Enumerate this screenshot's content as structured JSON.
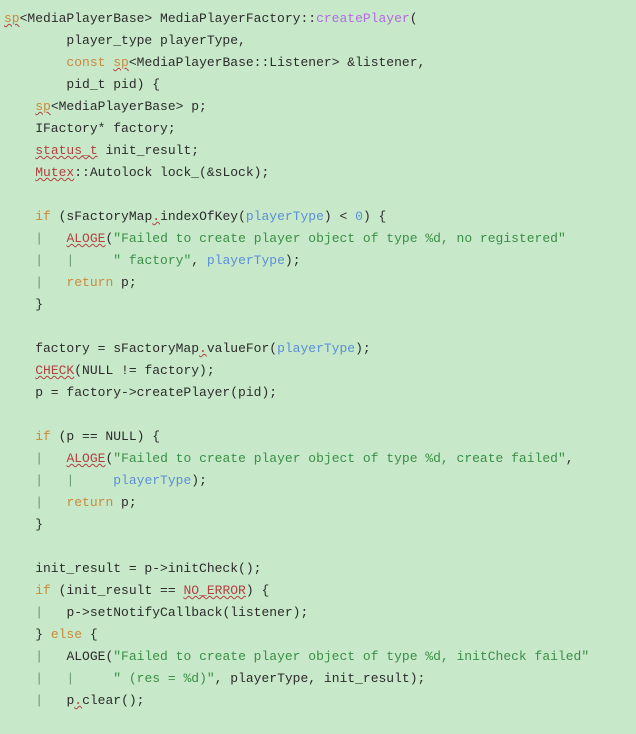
{
  "code": {
    "l1": {
      "a": "sp",
      "b": "<MediaPlayerBase> MediaPlayerFactory::",
      "c": "createPlayer",
      "d": "("
    },
    "l2": {
      "a": "        player_type playerType,"
    },
    "l3": {
      "a": "        ",
      "b": "const",
      "c": " ",
      "d": "sp",
      "e": "<MediaPlayerBase::Listener> &listener,"
    },
    "l4": {
      "a": "        pid_t pid) {"
    },
    "l5": {
      "a": "    ",
      "b": "sp",
      "c": "<MediaPlayerBase> p;"
    },
    "l6": {
      "a": "    IFactory* factory;"
    },
    "l7": {
      "a": "    ",
      "b": "status_t",
      "c": " init_result;"
    },
    "l8": {
      "a": "    ",
      "b": "Mutex",
      "c": "::Autolock lock_(&sLock);"
    },
    "l9": {
      "a": ""
    },
    "l10": {
      "a": "    ",
      "b": "if",
      "c": " (sFactoryMap",
      "d": ".",
      "e": "indexOfKey(",
      "f": "playerType",
      "g": ") < ",
      "h": "0",
      "i": ") {"
    },
    "l11": {
      "a": "    ",
      "g": "|   ",
      "b": "ALOGE",
      "c": "(",
      "d": "\"Failed to create player object of type %d, no registered\""
    },
    "l12": {
      "a": "    ",
      "g": "|   ",
      "h": "|     ",
      "d": "\" factory\"",
      "e": ", ",
      "f": "playerType",
      "i": ");"
    },
    "l13": {
      "a": "    ",
      "g": "|   ",
      "b": "return",
      "c": " p;"
    },
    "l14": {
      "a": "    }"
    },
    "l15": {
      "a": ""
    },
    "l16": {
      "a": "    factory = sFactoryMap",
      "d": ".",
      "e": "valueFor(",
      "f": "playerType",
      "g": ");"
    },
    "l17": {
      "a": "    ",
      "b": "CHECK",
      "c": "(NULL != factory);"
    },
    "l18": {
      "a": "    p = factory->createPlayer(pid);"
    },
    "l19": {
      "a": ""
    },
    "l20": {
      "a": "    ",
      "b": "if",
      "c": " (p == NULL) {"
    },
    "l21": {
      "a": "    ",
      "g": "|   ",
      "b": "ALOGE",
      "c": "(",
      "d": "\"Failed to create player object of type %d, create failed\"",
      "e": ","
    },
    "l22": {
      "a": "    ",
      "g": "|   ",
      "h": "|     ",
      "f": "playerType",
      "i": ");"
    },
    "l23": {
      "a": "    ",
      "g": "|   ",
      "b": "return",
      "c": " p;"
    },
    "l24": {
      "a": "    }"
    },
    "l25": {
      "a": ""
    },
    "l26": {
      "a": "    init_result = p->initCheck();"
    },
    "l27": {
      "a": "    ",
      "b": "if",
      "c": " (init_result == ",
      "d": "NO_ERROR",
      "e": ") {"
    },
    "l28": {
      "a": "    ",
      "g": "|   ",
      "c": "p->setNotifyCallback(listener);"
    },
    "l29": {
      "a": "    } ",
      "b": "else",
      "c": " {"
    },
    "l30": {
      "a": "    ",
      "g": "|   ",
      "c": "ALOGE(",
      "d": "\"Failed to create player object of type %d, initCheck failed\""
    },
    "l31": {
      "a": "    ",
      "g": "|   ",
      "h": "|     ",
      "d": "\" (res = %d)\"",
      "e": ", playerType, init_result);"
    },
    "l32": {
      "a": "    ",
      "g": "|   ",
      "c": "p",
      "d": ".",
      "e": "clear();"
    }
  }
}
